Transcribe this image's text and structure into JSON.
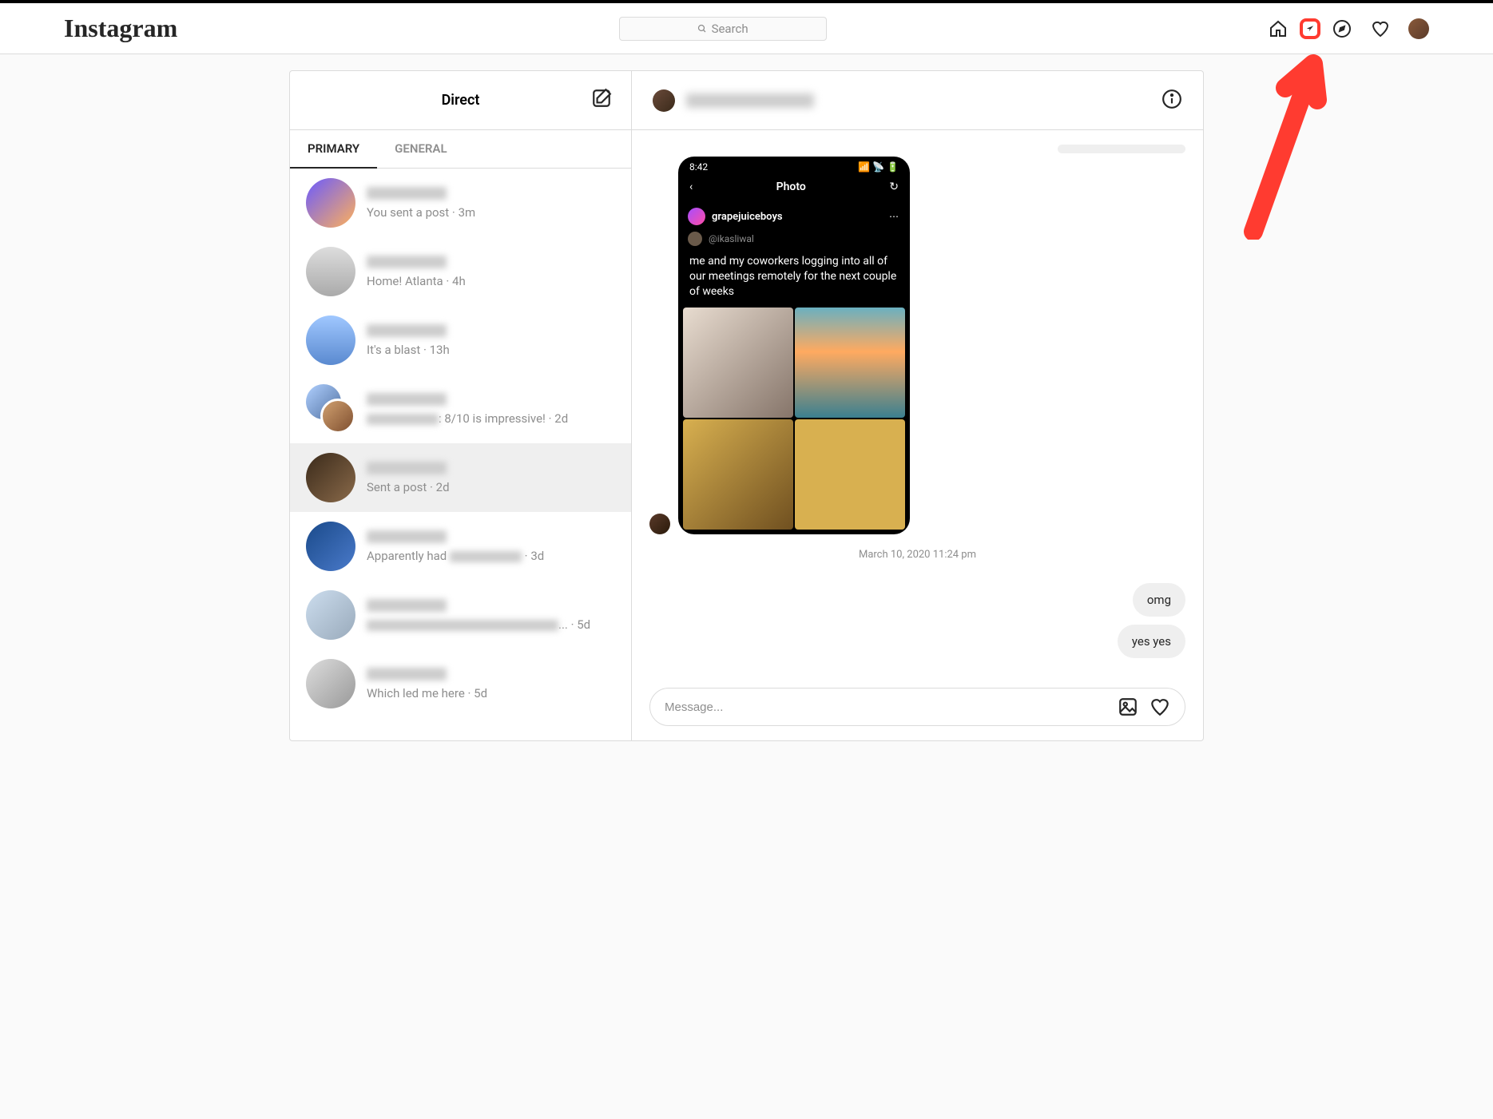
{
  "brand": "Instagram",
  "search": {
    "placeholder": "Search"
  },
  "sidebar": {
    "title": "Direct",
    "tabs": {
      "primary": "PRIMARY",
      "general": "GENERAL"
    },
    "conversations": [
      {
        "preview_pre": "You sent a post",
        "time": "3m",
        "avatar": "linear-gradient(135deg,#6a5aff,#ffb05a)"
      },
      {
        "preview_pre": "Home! Atlanta",
        "time": "4h",
        "avatar": "linear-gradient(180deg,#ddd,#aaa)"
      },
      {
        "preview_pre": "It's a blast",
        "time": "13h",
        "avatar": "linear-gradient(180deg,#a0c8ff,#5a8ad0)"
      },
      {
        "preview_pre": "",
        "preview_blur_w": 90,
        "preview_post": ": 8/10 is impressive!",
        "time": "2d",
        "double": true
      },
      {
        "preview_pre": "Sent a post",
        "time": "2d",
        "avatar": "linear-gradient(135deg,#3a2a1a,#8a6a4a)",
        "selected": true
      },
      {
        "preview_pre": "Apparently had ",
        "preview_blur_w": 90,
        "preview_post": "",
        "time": "3d",
        "avatar": "linear-gradient(135deg,#1a4a8a,#4a7aca)"
      },
      {
        "preview_pre": "",
        "preview_blur_w": 240,
        "preview_post": "...",
        "time": "5d",
        "avatar": "linear-gradient(135deg,#cde,#9ab)"
      },
      {
        "preview_pre": "Which led me here",
        "time": "5d",
        "avatar": "linear-gradient(135deg,#ddd,#999)"
      }
    ]
  },
  "chat": {
    "timestamp": "March 10, 2020 11:24 pm",
    "replies": [
      "omg",
      "yes yes"
    ],
    "composer_placeholder": "Message...",
    "shared_post": {
      "status_time": "8:42",
      "nav_title": "Photo",
      "poster": "grapejuiceboys",
      "sub_handle": "@ikasliwal",
      "text": "me and my coworkers logging into all of our meetings remotely for the next couple of weeks"
    }
  }
}
